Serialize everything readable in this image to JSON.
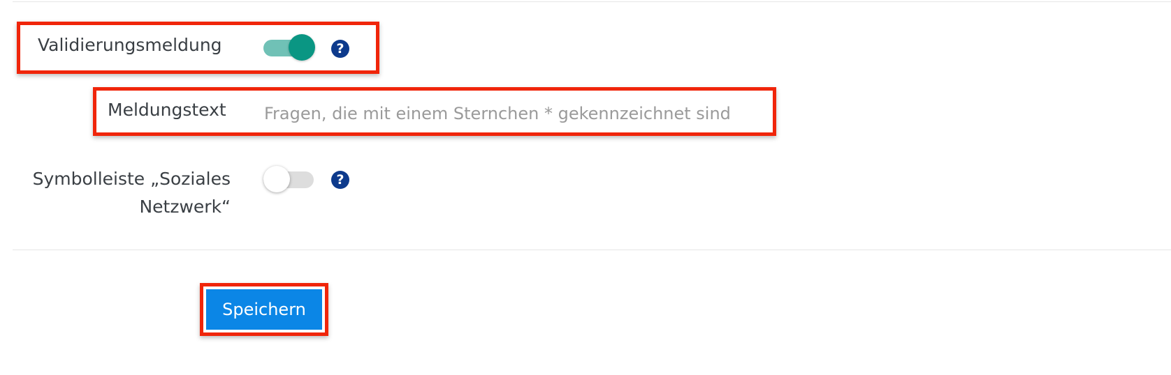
{
  "form": {
    "validation_message": {
      "label": "Validierungsmeldung",
      "enabled": true
    },
    "message_text": {
      "label": "Meldungstext",
      "placeholder": "Fragen, die mit einem Sternchen * gekennzeichnet sind",
      "value": ""
    },
    "social_toolbar": {
      "label_line1": "Symbolleiste „Soziales",
      "label_line2": "Netzwerk“",
      "enabled": false
    },
    "help_symbol": "?",
    "save_label": "Speichern"
  },
  "colors": {
    "toggle_on_track": "#70c1b6",
    "toggle_on_knob": "#0a9683",
    "toggle_off_track": "#dddddd",
    "help_icon": "#0d3a8c",
    "save_button": "#0b86e6",
    "highlight": "#f0250a"
  }
}
